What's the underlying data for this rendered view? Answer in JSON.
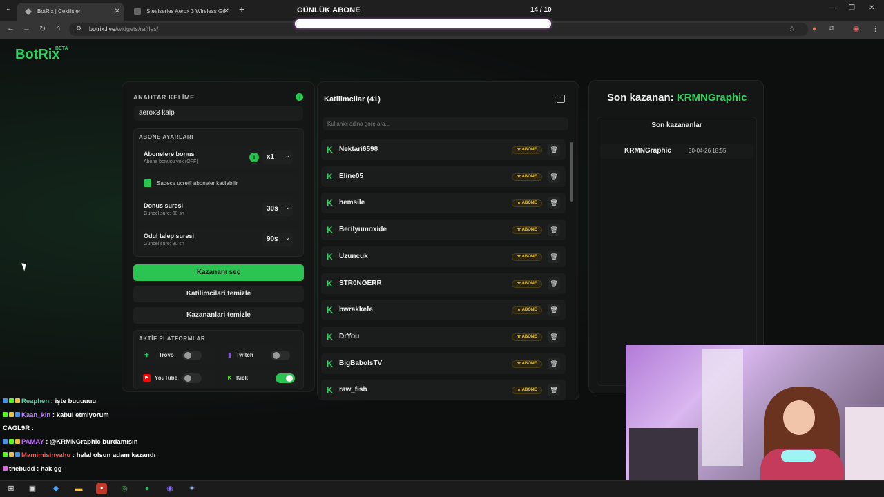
{
  "browser": {
    "tabs": [
      {
        "title": "BotRix | Cekilisler"
      },
      {
        "title": "Steelseries Aerox 3 Wireless Ge"
      }
    ],
    "url_domain": "botrix.live",
    "url_path": "/widgets/raffles/"
  },
  "overlay_goal": {
    "label": "GÜNLÜK ABONE",
    "count": "14 / 10",
    "progress_fraction": 1.0
  },
  "logo": {
    "name": "BotRix",
    "badge": "BETA"
  },
  "raffle": {
    "keyword_label": "ANAHTAR KELİME",
    "keyword_value": "aerox3 kalp",
    "sub_settings_label": "ABONE AYARLARI",
    "sub_bonus": {
      "title": "Abonelere bonus",
      "subtitle": "Abone bonusu yok (OFF)",
      "value": "x1"
    },
    "subs_only": {
      "label": "Sadece ucretli aboneler katilabilir",
      "checked": true
    },
    "bonus_duration": {
      "title": "Donus suresi",
      "subtitle": "Guncel sure: 30 sn",
      "value": "30s"
    },
    "claim_duration": {
      "title": "Odul talep suresi",
      "subtitle": "Guncel sure: 90 sn",
      "value": "90s"
    },
    "pick_winner": "Kazananı seç",
    "clear_participants": "Katilimcilari temizle",
    "clear_winners": "Kazananlari temizle",
    "platforms_label": "AKTİF PLATFORMLAR",
    "platforms": [
      {
        "name": "Trovo",
        "enabled": false,
        "color": "#19d66b"
      },
      {
        "name": "Twitch",
        "enabled": false,
        "color": "#9146ff"
      },
      {
        "name": "YouTube",
        "enabled": false,
        "color": "#ff0000"
      },
      {
        "name": "Kick",
        "enabled": true,
        "color": "#53fc18"
      }
    ]
  },
  "participants": {
    "title": "Katilimcilar (41)",
    "search_placeholder": "Kullanici adina gore ara...",
    "badge_label": "ABONE",
    "rows": [
      "Nektari6598",
      "Eline05",
      "hemsile",
      "Berilyumoxide",
      "Uzuncuk",
      "STR0NGERR",
      "bwrakkefe",
      "DrYou",
      "BigBabolsTV",
      "raw_fish"
    ]
  },
  "winners": {
    "last_winner_prefix": "Son kazanan:",
    "last_winner_name": "KRMNGraphic",
    "list_title": "Son kazananlar",
    "rows": [
      {
        "name": "KRMNGraphic",
        "date": "30-04-26 18:55"
      }
    ]
  },
  "chat": [
    {
      "user": "Reaphen",
      "color": "#4fd6a8",
      "msg": ": işte buuuuuu"
    },
    {
      "user": "Kaan_kln",
      "color": "#b57cff",
      "msg": ": kabul etmiyorum"
    },
    {
      "user": "CAGL9R",
      "color": "#ffffff",
      "msg": ":"
    },
    {
      "user": "PAMAY",
      "color": "#c36bff",
      "msg": ": @KRMNGraphic burdamısın"
    },
    {
      "user": "Mamimisinyahu",
      "color": "#ff5a5a",
      "msg": ": helal olsun adam kazandı"
    },
    {
      "user": "thebudd",
      "color": "#ffffff",
      "msg": ": hak gg"
    }
  ],
  "colors": {
    "accent": "#2bc453",
    "badge": "#e8c23a"
  }
}
